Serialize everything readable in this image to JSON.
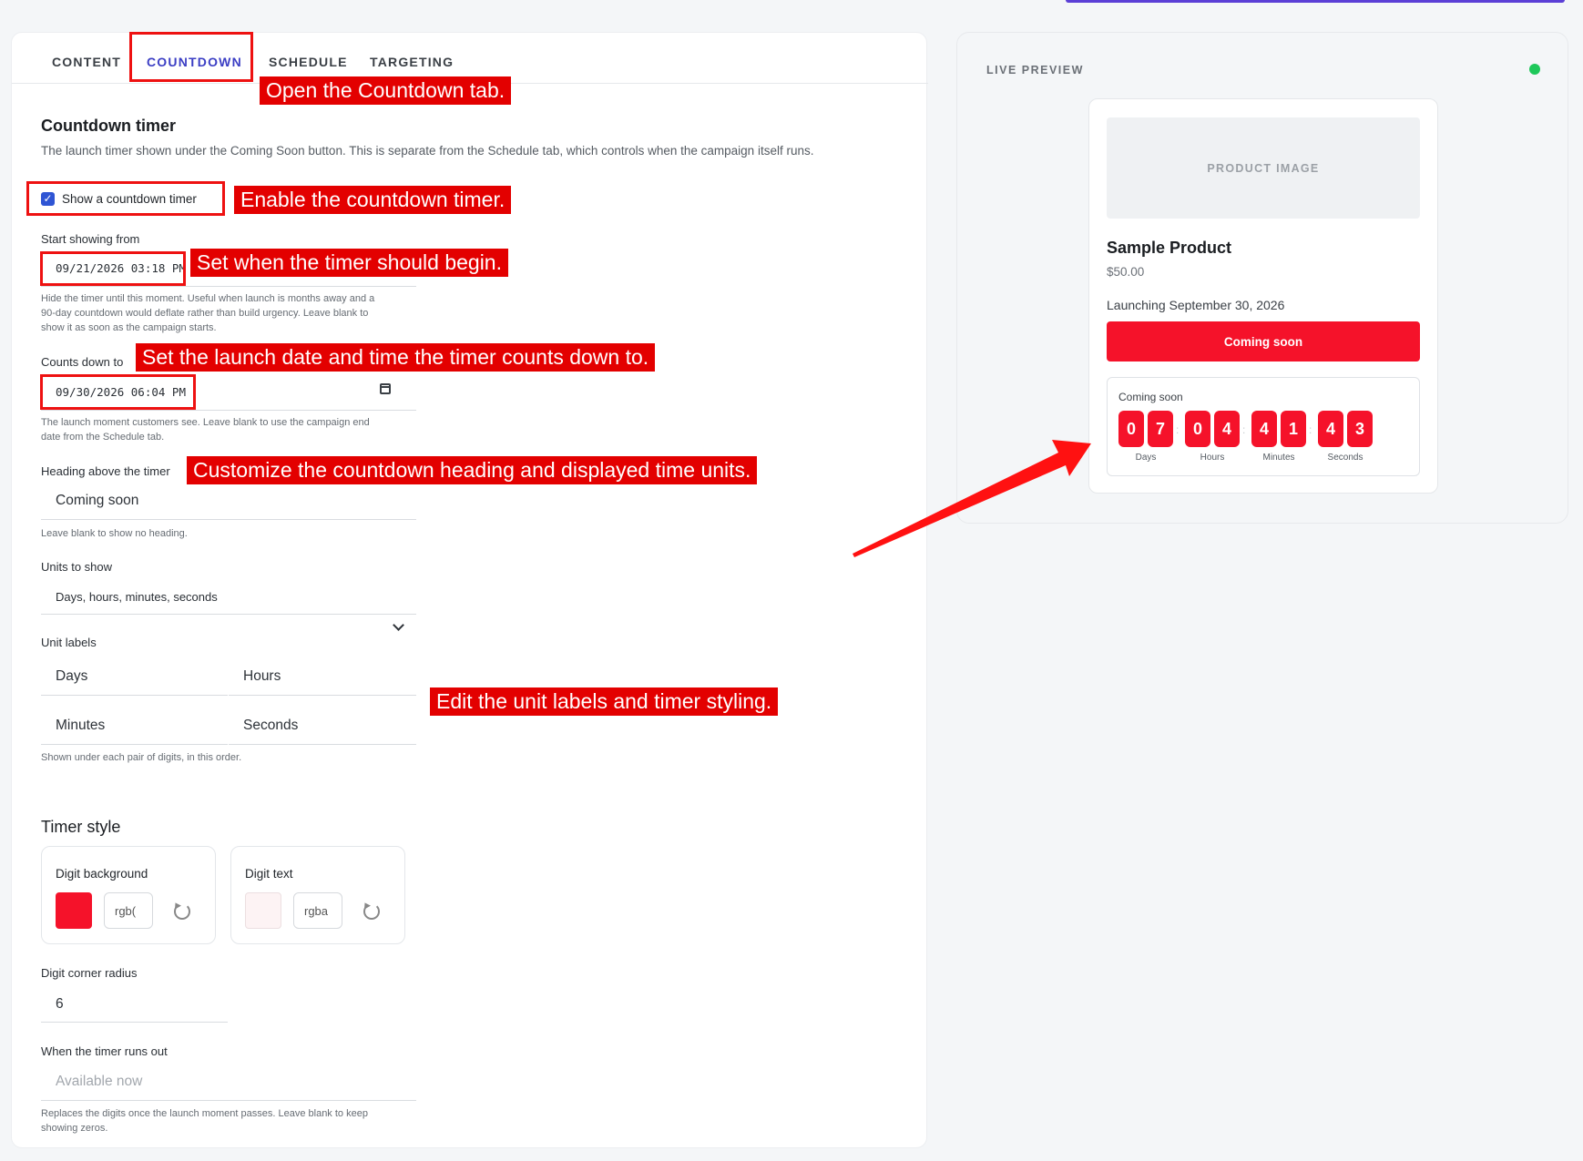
{
  "tabs": [
    {
      "label": "CONTENT"
    },
    {
      "label": "COUNTDOWN",
      "active": true
    },
    {
      "label": "SCHEDULE"
    },
    {
      "label": "TARGETING"
    }
  ],
  "section": {
    "title": "Countdown timer",
    "description": "The launch timer shown under the Coming Soon button. This is separate from the Schedule tab, which controls when the campaign itself runs."
  },
  "form": {
    "show_countdown_label": "Show a countdown timer",
    "show_countdown_checked": true,
    "start_label": "Start showing from",
    "start_value": "09/21/2026 03:18 PM",
    "start_hint_1": "Hide the timer until this moment. Useful when launch is months away and a",
    "start_hint_2": "90-day countdown would deflate rather than build urgency. Leave blank to",
    "start_hint_3": "show it as soon as the campaign starts.",
    "end_label": "Counts down to",
    "end_value": "09/30/2026 06:04 PM",
    "end_hint_1": "The launch moment customers see. Leave blank to use the campaign end",
    "end_hint_2": "date from the Schedule tab.",
    "heading_label": "Heading above the timer",
    "heading_value": "Coming soon",
    "heading_hint": "Leave blank to show no heading.",
    "units_label": "Units to show",
    "units_value": "Days, hours, minutes, seconds",
    "unit_labels_label": "Unit labels",
    "unit_days": "Days",
    "unit_hours": "Hours",
    "unit_minutes": "Minutes",
    "unit_seconds": "Seconds",
    "unit_labels_hint": "Shown under each pair of digits, in this order.",
    "timer_style_heading": "Timer style",
    "digit_bg_label": "Digit background",
    "digit_bg_value": "rgb(",
    "digit_bg_color": "#f5122a",
    "digit_text_label": "Digit text",
    "digit_text_value": "rgba",
    "digit_text_color": "#fdf3f4",
    "radius_label": "Digit corner radius",
    "radius_value": "6",
    "runs_out_label": "When the timer runs out",
    "runs_out_placeholder": "Available now",
    "runs_out_hint_1": "Replaces the digits once the launch moment passes. Leave blank to keep",
    "runs_out_hint_2": "showing zeros."
  },
  "annotations": {
    "open_tab": "Open the Countdown tab.",
    "enable": "Enable the countdown timer.",
    "set_start": "Set when the timer should begin.",
    "set_end": "Set the launch date and time the timer counts down to.",
    "customize": "Customize the countdown heading and displayed time units.",
    "edit_labels": "Edit the unit labels and timer styling."
  },
  "preview": {
    "label": "LIVE PREVIEW",
    "status_color": "#1ec85a",
    "image_placeholder": "PRODUCT IMAGE",
    "product_name": "Sample Product",
    "price": "$50.00",
    "launch_text": "Launching September 30, 2026",
    "cta_label": "Coming soon",
    "timer_heading": "Coming soon",
    "digits": [
      "0",
      "7",
      "0",
      "4",
      "4",
      "1",
      "4",
      "3"
    ],
    "separator": ":",
    "units": [
      "Days",
      "Hours",
      "Minutes",
      "Seconds"
    ]
  },
  "colors": {
    "accent": "#3b3ec4",
    "brand_red": "#f5122a",
    "annotation_red": "#e30000"
  }
}
